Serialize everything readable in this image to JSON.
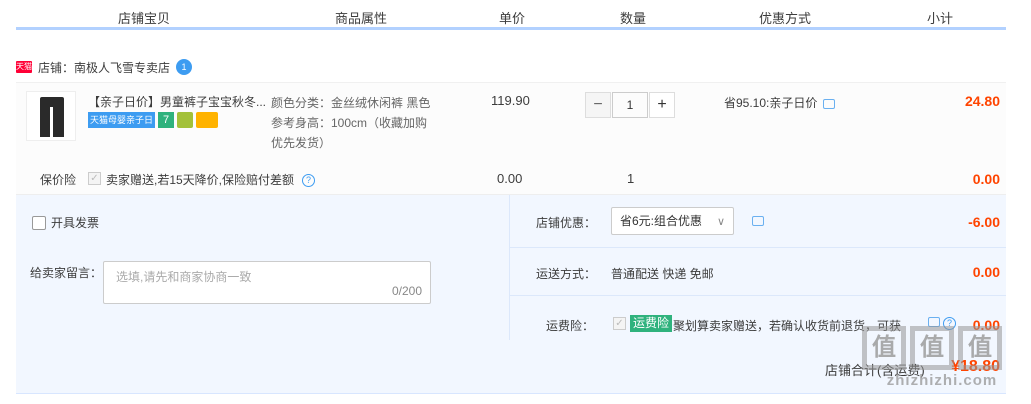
{
  "columns": [
    "店铺宝贝",
    "商品属性",
    "单价",
    "数量",
    "优惠方式",
    "小计"
  ],
  "shop": {
    "badge": "天猫",
    "label": "店铺：南极人飞雪专卖店",
    "chat_badge": "1"
  },
  "item": {
    "title": "【亲子日价】男童裤子宝宝秋冬...",
    "tags": {
      "blue": "天猫母婴亲子日",
      "green": "7"
    },
    "attrs": [
      "颜色分类：金丝绒休闲裤 黑色",
      "参考身高：100cm（收藏加购 优先发货）"
    ],
    "price": "119.90",
    "qty": "1",
    "promo": "省95.10:亲子日价",
    "subtotal": "24.80",
    "stepper": {
      "minus": "−",
      "plus": "+"
    }
  },
  "insurance": {
    "label": "保价险",
    "text": "卖家赠送,若15天降价,保险赔付差额",
    "price": "0.00",
    "qty": "1",
    "subtotal": "0.00"
  },
  "order": {
    "invoice_label": "开具发票",
    "msg_label": "给卖家留言：",
    "msg_placeholder": "选填,请先和商家协商一致",
    "msg_count": "0/200",
    "shop_discount_label": "店铺优惠：",
    "shop_discount_value": "省6元:组合优惠",
    "shop_discount_amount": "-6.00",
    "shipping_label": "运送方式：",
    "shipping_method": "普通配送 快递 免邮",
    "shipping_amount": "0.00",
    "freight_ins_label": "运费险：",
    "freight_ins_badge": "运费险",
    "freight_ins_text": "聚划算卖家赠送，若确认收货前退货，可获",
    "freight_ins_amount": "0.00",
    "total_label": "店铺合计(含运费)",
    "total_value": "¥18.80"
  },
  "watermark": {
    "chars": [
      "值",
      "值",
      "值"
    ],
    "url": "zhizhizhi.com"
  }
}
